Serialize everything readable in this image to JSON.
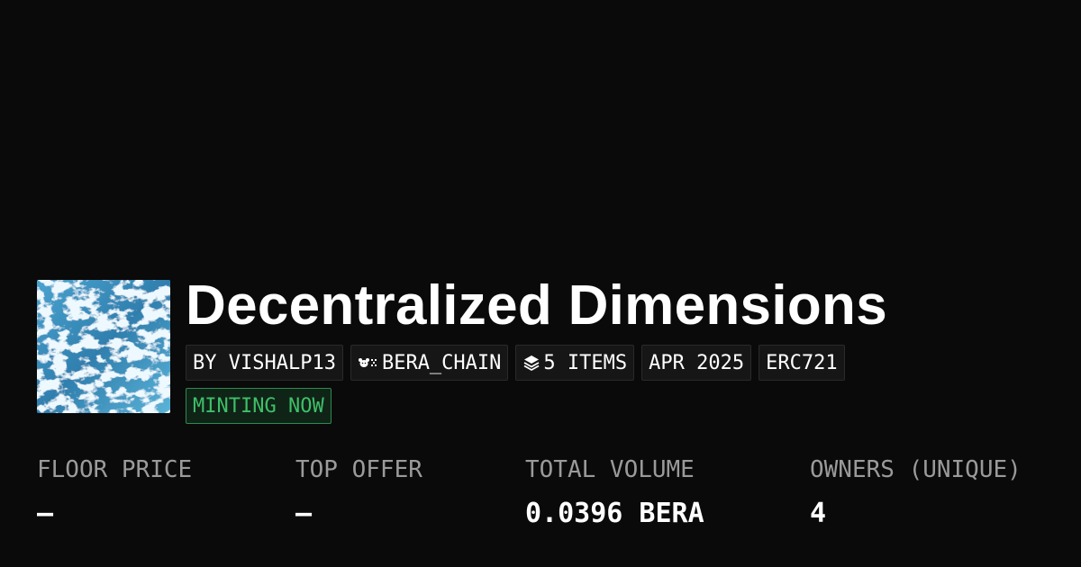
{
  "collection": {
    "title": "Decentralized Dimensions",
    "image_icon": "collection-artwork",
    "tags": {
      "creator": "BY VISHALP13",
      "chain": "BERA_CHAIN",
      "chain_icon": "bera-chain-icon",
      "items": "5 ITEMS",
      "items_icon": "layers-icon",
      "date": "APR 2025",
      "standard": "ERC721"
    },
    "status": "MINTING NOW"
  },
  "stats": [
    {
      "label": "FLOOR PRICE",
      "value": "–"
    },
    {
      "label": "TOP OFFER",
      "value": "–"
    },
    {
      "label": "TOTAL VOLUME",
      "value": "0.0396 BERA"
    },
    {
      "label": "OWNERS (UNIQUE)",
      "value": "4"
    }
  ],
  "colors": {
    "background": "#0a0a0a",
    "tag_background": "#161616",
    "minting_green": "#3fbf68",
    "label_gray": "#9a9a9a",
    "artwork_blue": "#3d8fb8"
  }
}
